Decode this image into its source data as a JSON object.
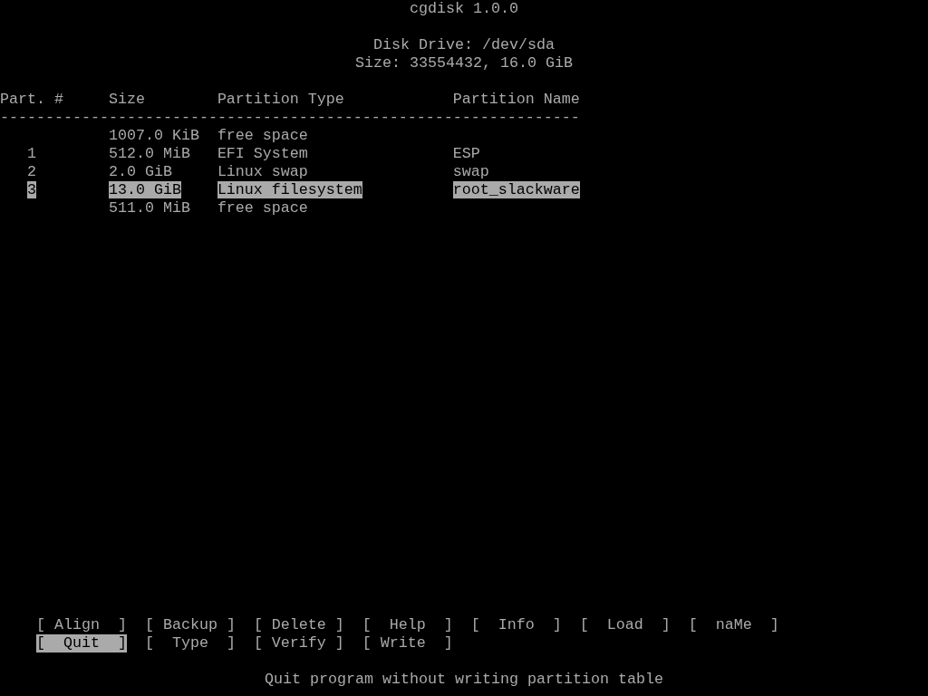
{
  "title": "cgdisk 1.0.0",
  "disk_drive": "Disk Drive: /dev/sda",
  "disk_size": "Size: 33554432, 16.0 GiB",
  "columns": [
    "Part. #",
    "Size",
    "Partition Type",
    "Partition Name"
  ],
  "separator": "----------------------------------------------------------------",
  "rows": [
    {
      "part": "",
      "size": "1007.0 KiB",
      "type": "free space",
      "name": "",
      "selected": false
    },
    {
      "part": "1",
      "size": "512.0 MiB",
      "type": "EFI System",
      "name": "ESP",
      "selected": false
    },
    {
      "part": "2",
      "size": "2.0 GiB",
      "type": "Linux swap",
      "name": "swap",
      "selected": false
    },
    {
      "part": "3",
      "size": "13.0 GiB",
      "type": "Linux filesystem",
      "name": "root_slackware",
      "selected": true
    },
    {
      "part": "",
      "size": "511.0 MiB",
      "type": "free space",
      "name": "",
      "selected": false
    }
  ],
  "menu": [
    [
      {
        "label": "[ Align  ]",
        "selected": false
      },
      {
        "label": "[ Backup ]",
        "selected": false
      },
      {
        "label": "[ Delete ]",
        "selected": false
      },
      {
        "label": "[  Help  ]",
        "selected": false
      },
      {
        "label": "[  Info  ]",
        "selected": false
      },
      {
        "label": "[  Load  ]",
        "selected": false
      },
      {
        "label": "[  naMe  ]",
        "selected": false
      }
    ],
    [
      {
        "label": "[  Quit  ]",
        "selected": true
      },
      {
        "label": "[  Type  ]",
        "selected": false
      },
      {
        "label": "[ Verify ]",
        "selected": false
      },
      {
        "label": "[ Write  ]",
        "selected": false
      }
    ]
  ],
  "status": "Quit program without writing partition table"
}
